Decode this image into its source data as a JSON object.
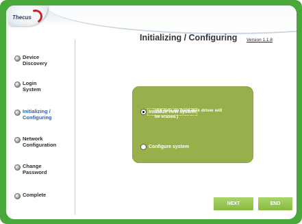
{
  "brand": {
    "logo_text": "Thecus"
  },
  "version_link": "Version 1.1.8",
  "page_title": "Initializing / Configuring",
  "sidebar": {
    "items": [
      {
        "label": "Device\nDiscovery",
        "active": false
      },
      {
        "label": "Login\nSystem",
        "active": false
      },
      {
        "label": "Initializing /\nConfiguring",
        "active": true
      },
      {
        "label": "Network\nConfiguration",
        "active": false
      },
      {
        "label": "Change\nPassword",
        "active": false
      },
      {
        "label": "Complete",
        "active": false
      }
    ]
  },
  "options": {
    "init_label": "Initialize new system",
    "init_note": "(All data on hard disk driver will\nbe erased.)",
    "init_checked": true,
    "config_label": "Configure system",
    "config_checked": false
  },
  "buttons": {
    "next": "NEXT",
    "end": "END"
  },
  "colors": {
    "frame": "#4aa83a",
    "option_box": "#97b04c",
    "button": "#8fc34a",
    "active_nav": "#2a5fb0"
  }
}
